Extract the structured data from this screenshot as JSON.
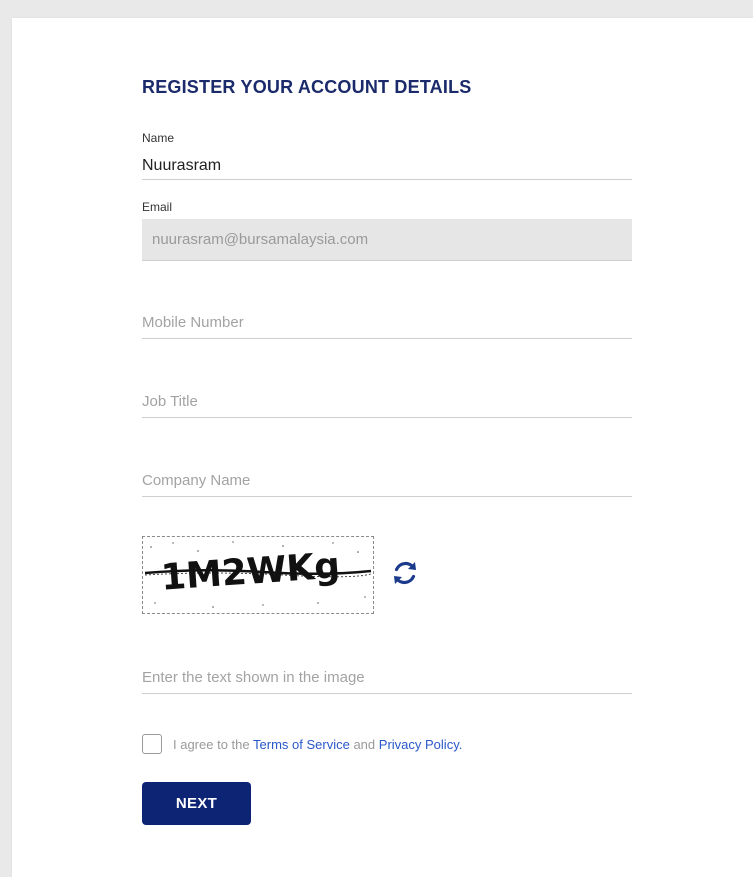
{
  "form": {
    "title": "REGISTER YOUR ACCOUNT DETAILS",
    "name_label": "Name",
    "name_value": "Nuurasram",
    "email_label": "Email",
    "email_value": "nuurasram@bursamalaysia.com",
    "mobile_placeholder": "Mobile Number",
    "job_title_placeholder": "Job Title",
    "company_placeholder": "Company Name",
    "captcha_text": "1M2WKg",
    "captcha_input_placeholder": "Enter the text shown in the image",
    "agree_prefix": "I agree to the",
    "terms_link": "Terms of Service",
    "agree_and": "and",
    "privacy_link": "Privacy Policy",
    "agree_suffix": ".",
    "next_label": "NEXT"
  },
  "icons": {
    "refresh": "refresh-icon",
    "checkbox": "checkbox-icon"
  },
  "colors": {
    "title": "#1b2a6b",
    "button": "#0d2475",
    "link": "#2a58c8",
    "refresh": "#1b3a8c"
  }
}
